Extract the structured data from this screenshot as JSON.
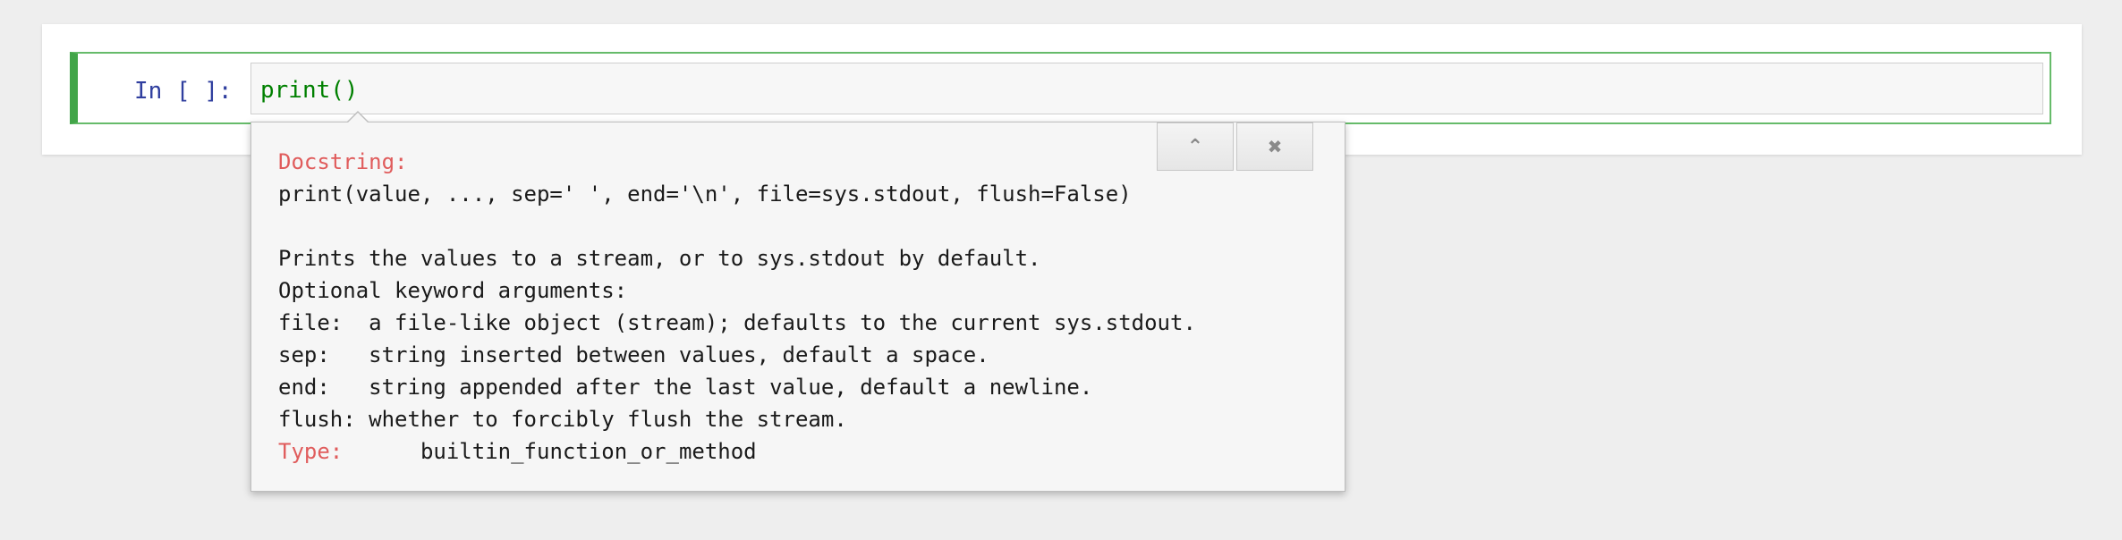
{
  "cell": {
    "prompt": "In [ ]:",
    "code": "print()"
  },
  "tooltip": {
    "buttons": {
      "expand_icon": "⌃",
      "close_icon": "✖"
    },
    "docstring_label": "Docstring:",
    "signature": "print(value, ..., sep=' ', end='\\n', file=sys.stdout, flush=False)",
    "description": [
      "Prints the values to a stream, or to sys.stdout by default.",
      "Optional keyword arguments:",
      "file:  a file-like object (stream); defaults to the current sys.stdout.",
      "sep:   string inserted between values, default a space.",
      "end:   string appended after the last value, default a newline.",
      "flush: whether to forcibly flush the stream."
    ],
    "type_label": "Type:",
    "type_value": "builtin_function_or_method"
  },
  "colors": {
    "cell_border_selected": "#42a548",
    "prompt": "#303f9f",
    "code_builtin": "#008000",
    "doc_label": "#e05c5c"
  }
}
